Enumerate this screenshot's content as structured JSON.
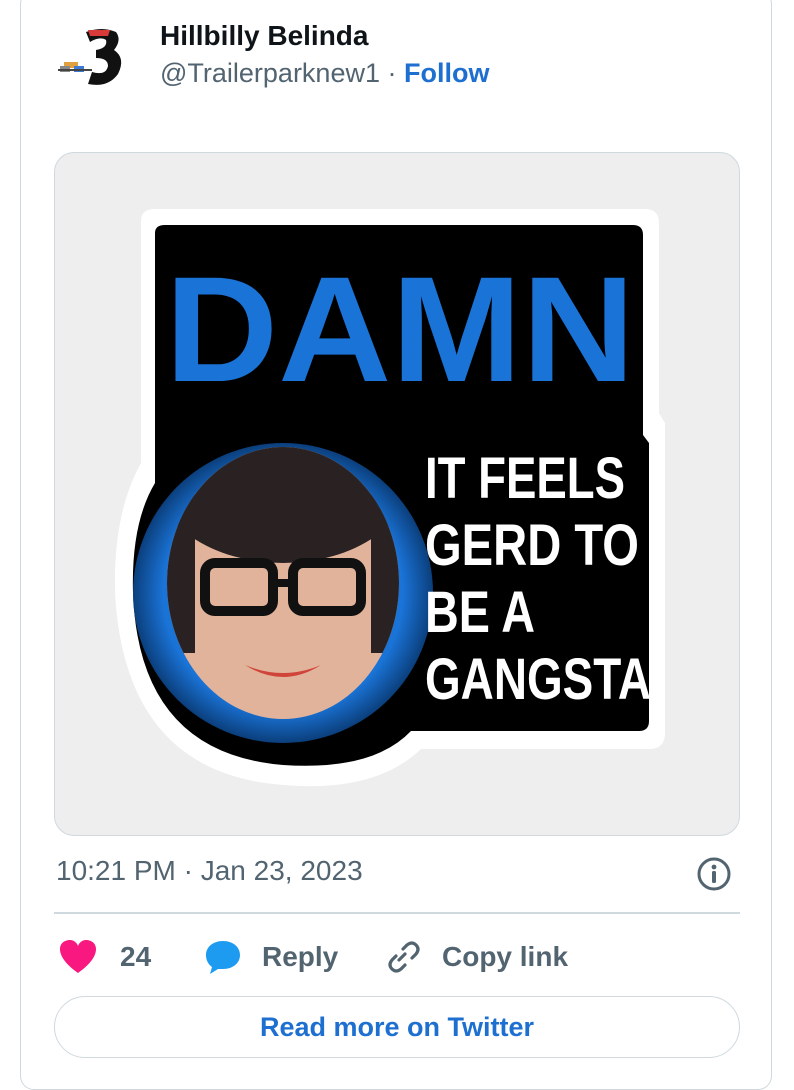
{
  "author": {
    "display_name": "Hillbilly Belinda",
    "handle": "@Trailerparknew1",
    "separator": " · ",
    "follow_label": "Follow",
    "avatar_icon": "number-3-logo-icon"
  },
  "media": {
    "sticker_title": "DAMN",
    "sticker_lines": [
      "IT FEELS",
      "GERD TO",
      "BE A",
      "GANGSTA"
    ],
    "accent_color": "#1a73d6"
  },
  "meta": {
    "timestamp": "10:21 PM · Jan 23, 2023",
    "info_icon": "info-icon"
  },
  "actions": {
    "like_count": "24",
    "reply_label": "Reply",
    "copy_link_label": "Copy link"
  },
  "footer": {
    "read_more_label": "Read more on Twitter"
  },
  "colors": {
    "like": "#f91880",
    "link": "#1d6fd0",
    "muted": "#536471",
    "reply_bubble": "#1d9bf0"
  }
}
